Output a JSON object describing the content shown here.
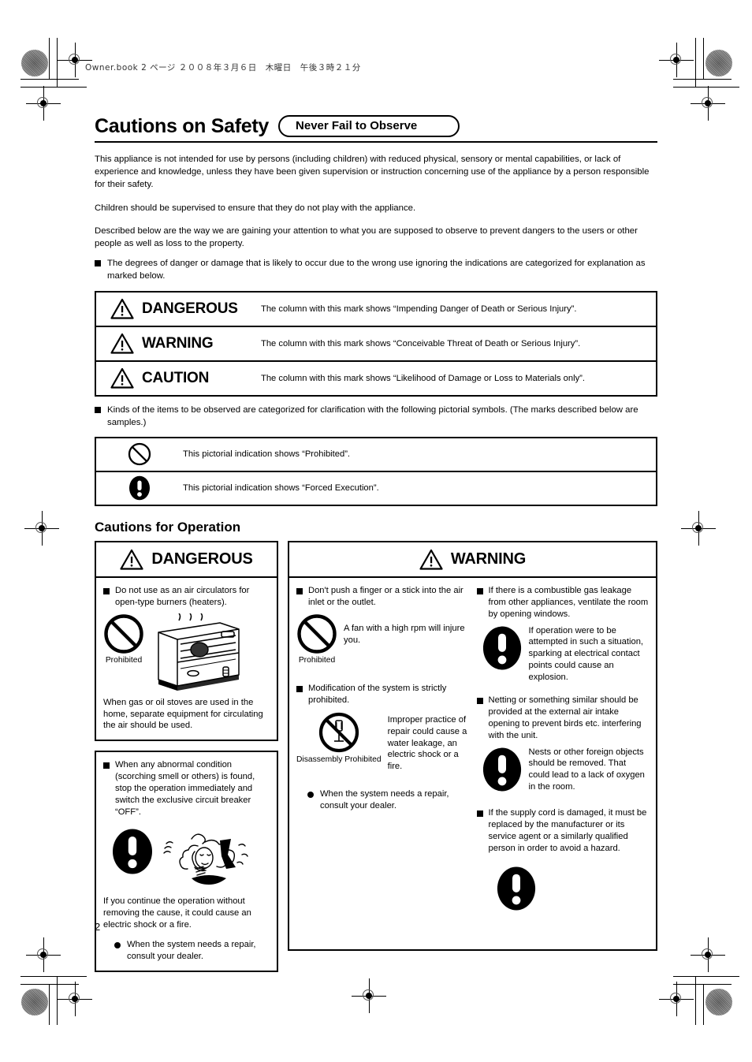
{
  "print_header": "Owner.book  2 ページ  ２００８年３月６日　木曜日　午後３時２１分",
  "page_number": "2",
  "title": {
    "main": "Cautions on Safety",
    "pill": "Never Fail to Observe"
  },
  "intro": {
    "p1": "This appliance is not intended for use by persons (including children) with reduced physical, sensory or mental capabilities, or lack of experience and knowledge, unless they have been given supervision or instruction concerning use of the appliance by a person responsible for their safety.",
    "p2": "Children should be supervised to ensure that they do not play with the appliance.",
    "p3": "Described below are the way we are gaining your attention to what you are supposed to observe to prevent dangers to the users or other people as well as loss to the property.",
    "bullet1": "The degrees of danger or damage that is likely to occur due to the wrong use ignoring the indications are categorized for explanation as marked below.",
    "bullet2": "Kinds of the items to be observed are categorized for clarification with the following pictorial symbols. (The marks described below are samples.)"
  },
  "levels": [
    {
      "icon": "warning-triangle-icon",
      "name": "DANGEROUS",
      "description": "The column with this mark shows “Impending Danger of Death or Serious Injury”."
    },
    {
      "icon": "warning-triangle-icon",
      "name": "WARNING",
      "description": "The column with this mark shows “Conceivable Threat of Death or Serious Injury”."
    },
    {
      "icon": "warning-triangle-icon",
      "name": "CAUTION",
      "description": "The column with this mark shows “Likelihood of Damage or Loss to Materials only”."
    }
  ],
  "symbols": [
    {
      "icon": "prohibited-icon",
      "description": "This pictorial indication shows “Prohibited”."
    },
    {
      "icon": "forced-execution-icon",
      "description": "This pictorial indication shows “Forced Execution”."
    }
  ],
  "operation": {
    "heading": "Cautions for Operation",
    "dangerous": {
      "title": "DANGEROUS",
      "items": [
        {
          "lead": "Do not use as an air circulators for open-type burners (heaters).",
          "icon": "prohibited-icon",
          "icon_caption": "Prohibited",
          "figure": "heater-illustration",
          "under": "When gas or oil stoves are used in the home, separate equipment for circulating the air should be used."
        },
        {
          "lead": "When any abnormal condition (scorching smell or others) is found, stop the operation immediately and switch the exclusive circuit breaker “OFF”.",
          "icon": "forced-execution-icon",
          "figure": "coughing-person-illustration",
          "under": "If you continue the operation without removing the cause, it could cause an electric shock or a fire.",
          "note": "When the system needs a repair, consult your dealer."
        }
      ]
    },
    "warning": {
      "title": "WARNING",
      "left_items": [
        {
          "lead": "Don't push a finger or a stick into the air inlet or the outlet.",
          "icon": "prohibited-icon",
          "icon_caption": "Prohibited",
          "side": "A fan with a high rpm will injure you."
        },
        {
          "lead": "Modification of the system is strictly prohibited.",
          "icon": "disassembly-prohibited-icon",
          "icon_caption": "Disassembly Prohibited",
          "side": "Improper practice of repair could cause a water leakage, an electric shock or a fire."
        }
      ],
      "left_note": "When the system needs a repair, consult your dealer.",
      "right_items": [
        {
          "lead": "If there is a combustible gas leakage from other appliances, ventilate the room by opening windows.",
          "icon": "forced-execution-icon",
          "side": "If operation were to be attempted in such a situation, sparking at electrical contact points could cause an explosion."
        },
        {
          "lead": "Netting or something similar should be provided at the external air intake opening to prevent birds etc. interfering with the unit.",
          "icon": "forced-execution-icon",
          "side": "Nests or other foreign objects should be removed. That could lead to a lack of oxygen in the room."
        },
        {
          "lead": "If the supply cord is damaged, it must be replaced by the manufacturer or its service agent or a similarly qualified person in order to avoid a hazard.",
          "icon": "forced-execution-icon",
          "side": ""
        }
      ]
    }
  }
}
